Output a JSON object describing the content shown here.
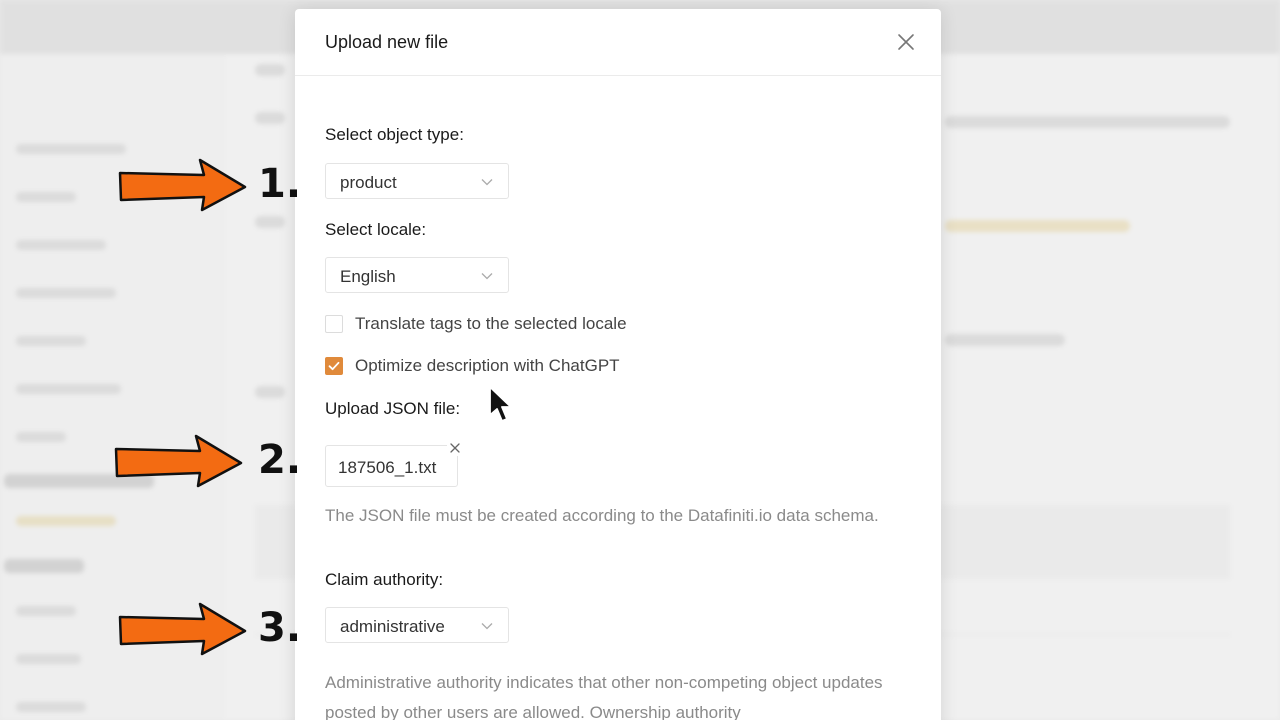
{
  "modal": {
    "title": "Upload new file",
    "object_type": {
      "label": "Select object type:",
      "value": "product"
    },
    "locale": {
      "label": "Select locale:",
      "value": "English"
    },
    "translate_tags": {
      "label": "Translate tags to the selected locale",
      "checked": false
    },
    "optimize_description": {
      "label": "Optimize description with ChatGPT",
      "checked": true
    },
    "upload_json": {
      "label": "Upload JSON file:",
      "file_name": "187506_1.txt",
      "help": "The JSON file must be created according to the Datafiniti.io data schema."
    },
    "claim_authority": {
      "label": "Claim authority:",
      "value": "administrative",
      "help": "Administrative authority indicates that other non-competing object updates posted by other users are allowed. Ownership authority"
    }
  },
  "annotations": {
    "step1": "1.",
    "step2": "2.",
    "step3": "3."
  },
  "colors": {
    "accent": "#e08a3b",
    "arrow_fill": "#f36b12"
  },
  "icons": {
    "close": "close-icon",
    "chevron": "chevron-down-icon",
    "check": "check-icon",
    "remove": "remove-file-icon",
    "cursor": "mouse-cursor-icon"
  }
}
